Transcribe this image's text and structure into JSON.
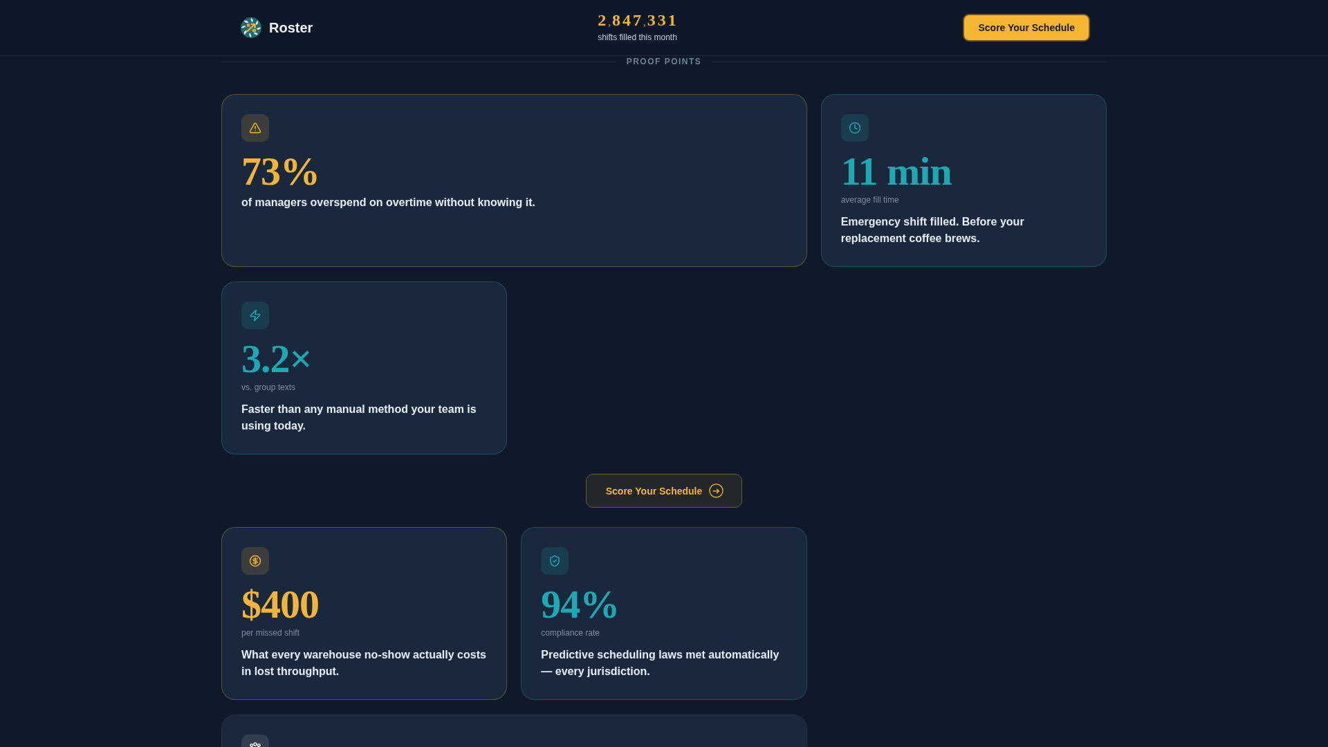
{
  "header": {
    "brand": "Roster",
    "counter": {
      "value": "2,847,331",
      "caption": "shifts filled this month"
    },
    "button": {
      "label": "Score Your Schedule"
    }
  },
  "proof_points": {
    "heading": "PROOF POINTS",
    "items": [
      {
        "kind": "stat",
        "color": "#f2b53a",
        "value": "73%",
        "description": "of managers overspend on overtime without knowing it."
      },
      {
        "kind": "stat",
        "color": "#1ea8b1",
        "value": "11 min",
        "caption": "average fill time",
        "description": "Emergency shift filled. Before your replacement coffee brews."
      },
      {
        "kind": "stat",
        "color": "#1ea8b1",
        "value": "3.2×",
        "caption": "vs. group texts",
        "description": "Faster than any manual method your team is using today."
      },
      {
        "kind": "cta",
        "label": "Score Your Schedule"
      },
      {
        "kind": "stat",
        "color": "#f2b53a",
        "value": "$400",
        "caption": "per missed shift",
        "description": "What every warehouse no-show actually costs in lost throughput."
      },
      {
        "kind": "stat",
        "color": "#1ea8b1",
        "value": "94%",
        "caption": "compliance rate",
        "description": "Predictive scheduling laws met automatically — every jurisdiction."
      },
      {
        "kind": "stat"
      }
    ]
  }
}
